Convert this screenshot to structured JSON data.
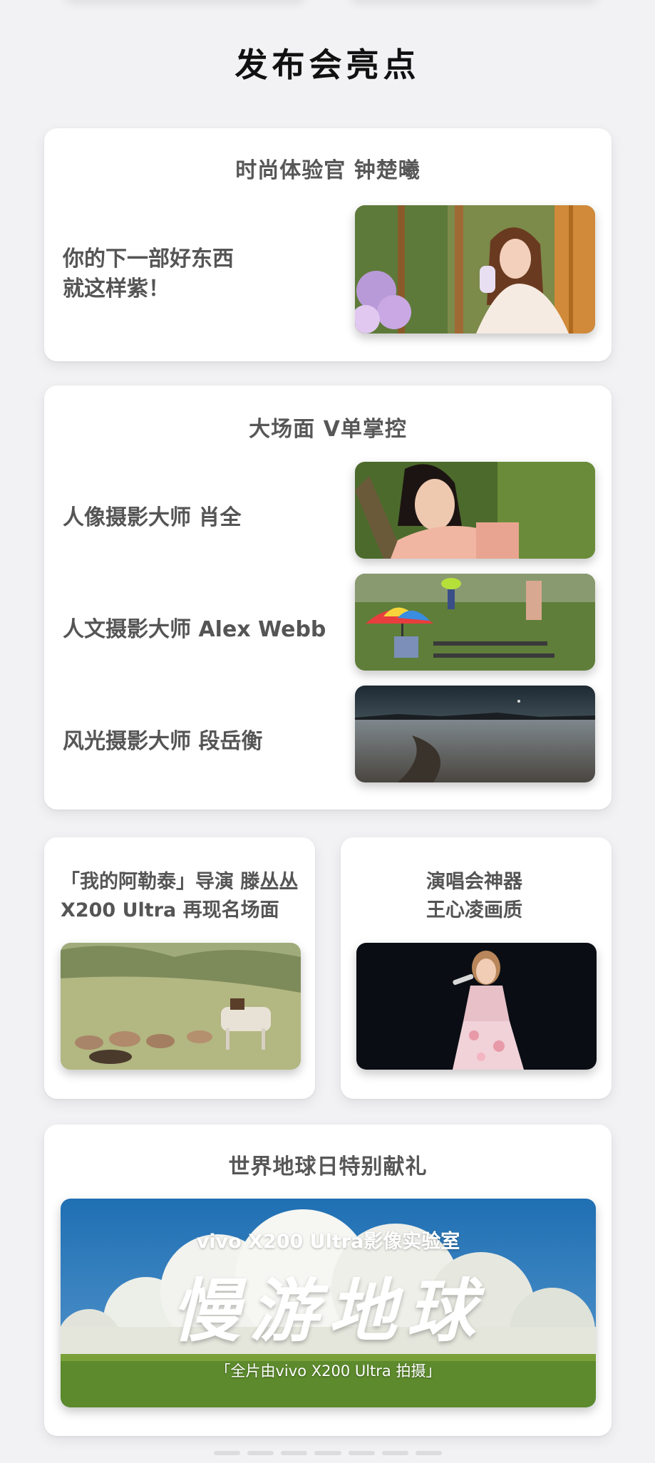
{
  "page": {
    "title": "发布会亮点"
  },
  "card_fashion": {
    "title": "时尚体验官 钟楚曦",
    "line1": "你的下一部好东西",
    "line2": "就这样紫！"
  },
  "card_masters": {
    "title": "大场面 V单掌控",
    "rows": [
      {
        "label": "人像摄影大师  肖全"
      },
      {
        "label": "人文摄影大师  Alex Webb"
      },
      {
        "label": "风光摄影大师  段岳衡"
      }
    ]
  },
  "card_director": {
    "line1": "「我的阿勒泰」导演 滕丛丛",
    "line2": "X200 Ultra 再现名场面"
  },
  "card_concert": {
    "line1": "演唱会神器",
    "line2": "王心凌画质"
  },
  "card_earth": {
    "title": "世界地球日特别献礼",
    "banner_top": "vivo X200 Ultra影像实验室",
    "banner_main": "慢游地球",
    "banner_bottom": "「全片由vivo X200 Ultra 拍摄」"
  },
  "colors": {
    "background": "#f2f2f4",
    "card": "#ffffff",
    "title": "#111111",
    "text": "#555555"
  }
}
